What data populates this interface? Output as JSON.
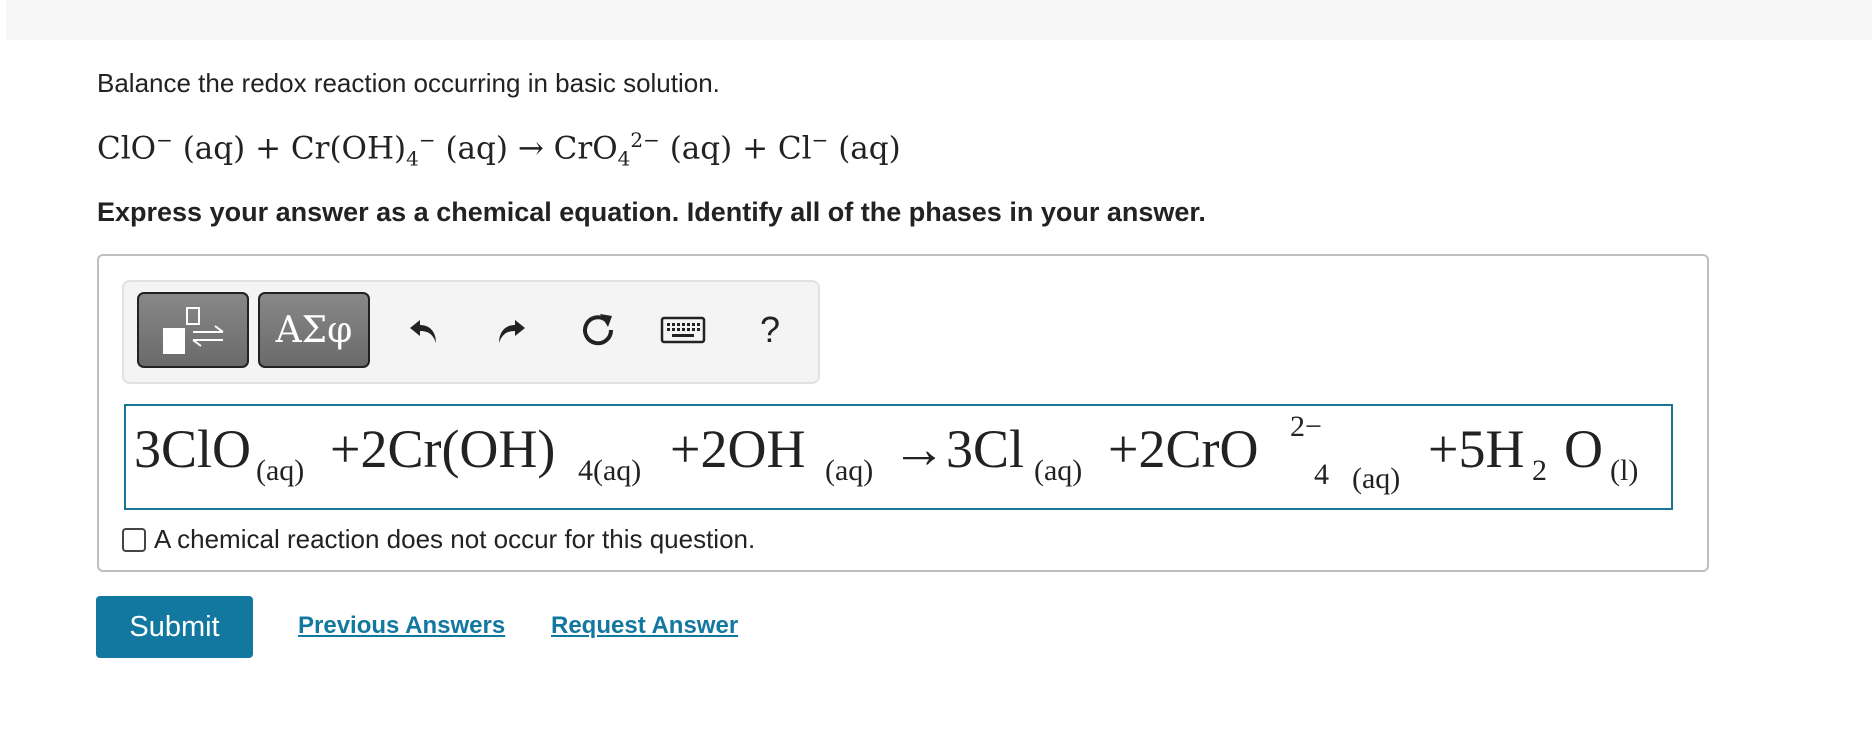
{
  "question": {
    "prompt": "Balance the redox reaction occurring in basic solution.",
    "reaction": {
      "r1": "ClO",
      "r1_charge": "−",
      "r1_phase": "(aq)",
      "plus1": "+",
      "r2": "Cr(OH)",
      "r2_sub": "4",
      "r2_charge": "−",
      "r2_phase": "(aq)",
      "arrow": "→",
      "p1": "CrO",
      "p1_sub": "4",
      "p1_charge": "2−",
      "p1_phase": "(aq)",
      "plus2": "+",
      "p2": "Cl",
      "p2_charge": "−",
      "p2_phase": "(aq)"
    },
    "instruction": "Express your answer as a chemical equation. Identify all of the phases in your answer."
  },
  "toolbar": {
    "greek_label": "ΑΣφ",
    "help_label": "?",
    "icons": [
      "templates-icon",
      "greek-letters",
      "undo-icon",
      "redo-icon",
      "reset-icon",
      "keyboard-icon",
      "help-icon"
    ]
  },
  "answer": {
    "t1": "3ClO",
    "t1_phase": "(aq)",
    "t2": "+2Cr(OH)",
    "t2_sub": "4(aq)",
    "t3": "+2OH",
    "t3_phase": "(aq)",
    "t4": "→3Cl",
    "t4_phase": "(aq)",
    "t5": "+2CrO",
    "t5_charge": "2−",
    "t5_sub": "4",
    "t5_phase": "(aq)",
    "t6": "+5H",
    "t6_sub": "2",
    "t6_o": "O",
    "t6_phase": "(l)"
  },
  "no_reaction_checkbox": {
    "label": "A chemical reaction does not occur for this question.",
    "checked": false
  },
  "actions": {
    "submit": "Submit",
    "previous_answers": "Previous Answers",
    "request_answer": "Request Answer"
  },
  "colors": {
    "accent": "#1378a0",
    "tool_button": "#7a7a7a"
  }
}
